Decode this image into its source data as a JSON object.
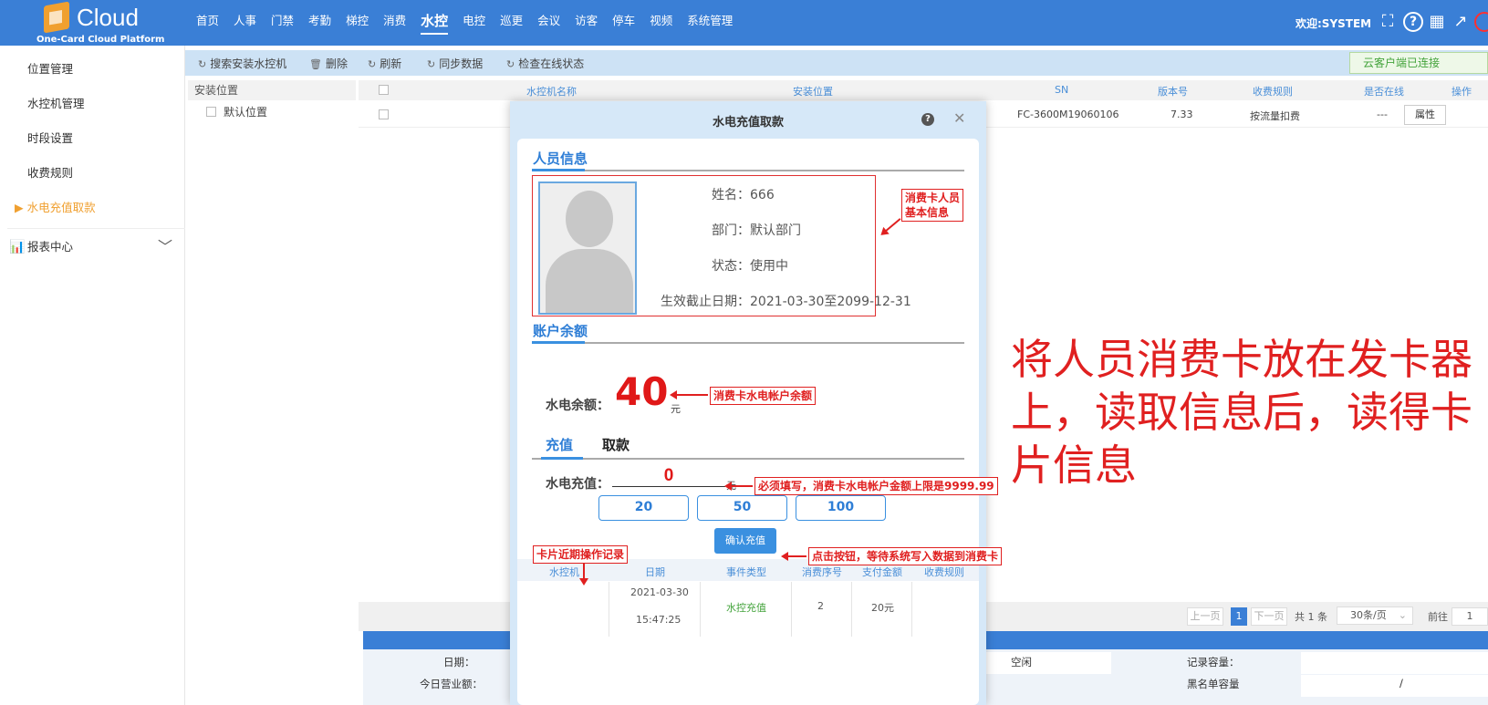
{
  "app": {
    "logo_text": "Cloud",
    "logo_sub": "One-Card Cloud Platform",
    "welcome": "欢迎:SYSTEM"
  },
  "nav": [
    "首页",
    "人事",
    "门禁",
    "考勤",
    "梯控",
    "消费",
    "水控",
    "电控",
    "巡更",
    "会议",
    "访客",
    "停车",
    "视频",
    "系统管理"
  ],
  "nav_active": "水控",
  "sidebar": {
    "items": [
      "位置管理",
      "水控机管理",
      "时段设置",
      "收费规则",
      "▶ 水电充值取款"
    ],
    "report": "报表中心"
  },
  "toolbar": {
    "search": "搜索安装水控机",
    "delete": "删除",
    "refresh": "刷新",
    "sync": "同步数据",
    "check": "检查在线状态",
    "connected": "云客户端已连接"
  },
  "tree": {
    "header": "安装位置",
    "node": "默认位置"
  },
  "grid": {
    "headers": [
      "水控机名称",
      "安装位置",
      "SN",
      "版本号",
      "收费规则",
      "是否在线",
      "操作"
    ],
    "row": {
      "sn": "FC-3600M19060106",
      "version": "7.33",
      "rule": "按流量扣费",
      "online": "---",
      "action": "属性"
    }
  },
  "pager": {
    "prev": "上一页",
    "current": "1",
    "next": "下一页",
    "total": "共 1 条",
    "per_page": "30条/页",
    "goto": "前往",
    "goto_val": "1"
  },
  "info": {
    "date_label": "日期：",
    "revenue_label": "今日营业额：",
    "status": "空闲",
    "record_cap": "记录容量：",
    "blacklist_cap": "黑名单容量",
    "blacklist_val": "/"
  },
  "dialog": {
    "title": "水电充值取款",
    "help": "?",
    "person_section": "人员信息",
    "name": "姓名：666",
    "dept": "部门：默认部门",
    "status": "状态：使用中",
    "valid": "生效截止日期：2021-03-30至2099-12-31",
    "balance_section": "账户余额",
    "balance_label": "水电余额：",
    "balance_value": "40",
    "unit": "元",
    "tab_recharge": "充值",
    "tab_withdraw": "取款",
    "amount_label": "水电充值：",
    "amount_value": "0",
    "quick_amounts": [
      "20",
      "50",
      "100"
    ],
    "confirm": "确认充值",
    "record_headers": [
      "水控机",
      "日期",
      "事件类型",
      "消费序号",
      "支付金额",
      "收费规则"
    ],
    "record": {
      "date": "2021-03-30",
      "time": "15:47:25",
      "event": "水控充值",
      "seq": "2",
      "amount": "20元"
    }
  },
  "annotations": {
    "person_info": "消费卡人员\n基本信息",
    "balance": "消费卡水电帐户余额",
    "amount": "必须填写，消费卡水电帐户金额上限是9999.99",
    "confirm": "点击按钮，等待系统写入数据到消费卡",
    "records": "卡片近期操作记录",
    "big_note": "将人员消费卡放在发卡器上，读取信息后，读得卡片信息"
  },
  "colors": {
    "primary": "#3a7fd6",
    "accent": "#f0a030",
    "annotation": "#e02020"
  }
}
